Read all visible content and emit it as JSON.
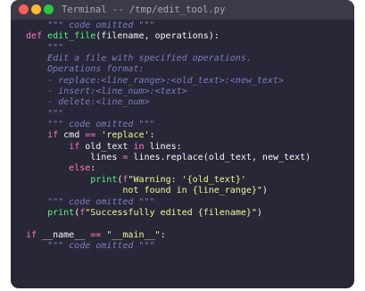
{
  "window": {
    "title": "Terminal -- /tmp/edit_tool.py"
  },
  "colors": {
    "background": "#272737",
    "titlebar": "#3a3a48",
    "close": "#ff5f57",
    "minimize": "#febc2e",
    "maximize": "#28c840",
    "keyword": "#ff79c6",
    "function": "#50fa7b",
    "string": "#f1fa8c",
    "comment": "#7b7ec4"
  },
  "code": [
    [
      {
        "t": "cm",
        "v": "    \"\"\" code omitted \"\"\""
      }
    ],
    [
      {
        "t": "kw",
        "v": "def "
      },
      {
        "t": "fn",
        "v": "edit_file"
      },
      {
        "t": "pl",
        "v": "(filename, operations):"
      }
    ],
    [
      {
        "t": "cm",
        "v": "    \"\"\""
      }
    ],
    [
      {
        "t": "cm",
        "v": "    Edit a file with specified operations."
      }
    ],
    [
      {
        "t": "cm",
        "v": "    Operations format:"
      }
    ],
    [
      {
        "t": "cm",
        "v": "    - replace:<line_range>:<old_text>:<new_text>"
      }
    ],
    [
      {
        "t": "cm",
        "v": "    - insert:<line_num>:<text>"
      }
    ],
    [
      {
        "t": "cm",
        "v": "    - delete:<line_num>"
      }
    ],
    [
      {
        "t": "cm",
        "v": "    \"\"\""
      }
    ],
    [
      {
        "t": "cm",
        "v": "    \"\"\" code omitted \"\"\""
      }
    ],
    [
      {
        "t": "pl",
        "v": "    "
      },
      {
        "t": "kw",
        "v": "if"
      },
      {
        "t": "pl",
        "v": " cmd "
      },
      {
        "t": "op",
        "v": "=="
      },
      {
        "t": "pl",
        "v": " "
      },
      {
        "t": "st",
        "v": "'replace'"
      },
      {
        "t": "pl",
        "v": ":"
      }
    ],
    [
      {
        "t": "pl",
        "v": "        "
      },
      {
        "t": "kw",
        "v": "if"
      },
      {
        "t": "pl",
        "v": " old_text "
      },
      {
        "t": "kw",
        "v": "in"
      },
      {
        "t": "pl",
        "v": " lines:"
      }
    ],
    [
      {
        "t": "pl",
        "v": "            lines "
      },
      {
        "t": "op",
        "v": "="
      },
      {
        "t": "pl",
        "v": " lines.replace(old_text, new_text)"
      }
    ],
    [
      {
        "t": "pl",
        "v": "        "
      },
      {
        "t": "kw",
        "v": "else"
      },
      {
        "t": "pl",
        "v": ":"
      }
    ],
    [
      {
        "t": "pl",
        "v": "            "
      },
      {
        "t": "fn",
        "v": "print"
      },
      {
        "t": "pl",
        "v": "("
      },
      {
        "t": "kw",
        "v": "f"
      },
      {
        "t": "st",
        "v": "\"Warning: '{old_text}'"
      }
    ],
    [
      {
        "t": "st",
        "v": "                  not found in {line_range}\""
      },
      {
        "t": "pl",
        "v": ")"
      }
    ],
    [
      {
        "t": "cm",
        "v": "    \"\"\" code omitted \"\"\""
      }
    ],
    [
      {
        "t": "pl",
        "v": "    "
      },
      {
        "t": "fn",
        "v": "print"
      },
      {
        "t": "pl",
        "v": "("
      },
      {
        "t": "kw",
        "v": "f"
      },
      {
        "t": "st",
        "v": "\"Successfully edited {filename}\""
      },
      {
        "t": "pl",
        "v": ")"
      }
    ],
    [
      {
        "t": "pl",
        "v": ""
      }
    ],
    [
      {
        "t": "kw",
        "v": "if"
      },
      {
        "t": "pl",
        "v": " __name__ "
      },
      {
        "t": "op",
        "v": "=="
      },
      {
        "t": "pl",
        "v": " "
      },
      {
        "t": "st",
        "v": "\"__main__\""
      },
      {
        "t": "pl",
        "v": ":"
      }
    ],
    [
      {
        "t": "cm",
        "v": "    \"\"\" code omitted \"\"\""
      }
    ]
  ]
}
